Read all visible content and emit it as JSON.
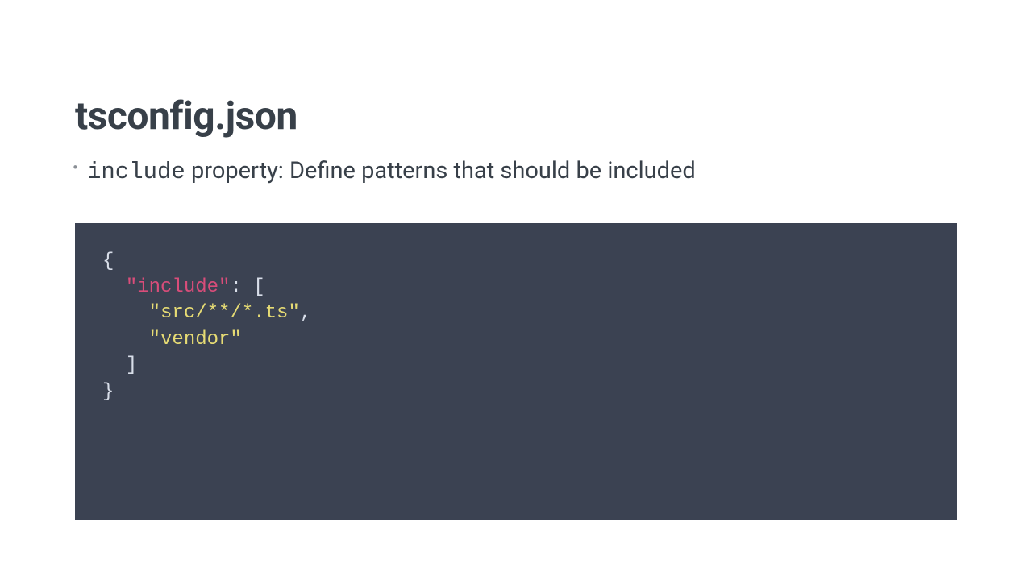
{
  "slide": {
    "title": "tsconfig.json",
    "bullet": {
      "code_word": "include",
      "rest": " property: Define patterns that should be included"
    },
    "code": {
      "line1_open_brace": "{",
      "line2_indent": "  ",
      "line2_key": "\"include\"",
      "line2_colon": ": ",
      "line2_bracket": "[",
      "line3_indent": "    ",
      "line3_value": "\"src/**/*.ts\"",
      "line3_comma": ",",
      "line4_indent": "    ",
      "line4_value": "\"vendor\"",
      "line5_indent": "  ",
      "line5_bracket": "]",
      "line6_close_brace": "}"
    }
  }
}
